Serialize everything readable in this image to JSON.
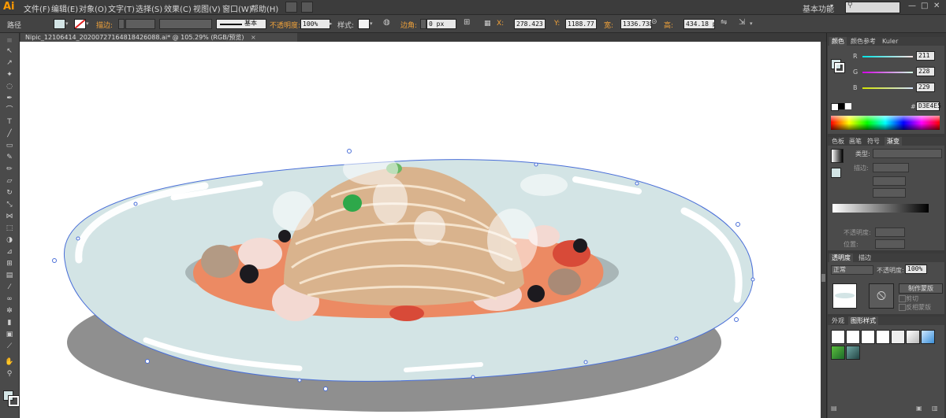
{
  "app": {
    "logo": "Ai"
  },
  "menu": [
    "文件(F)",
    "编辑(E)",
    "对象(O)",
    "文字(T)",
    "选择(S)",
    "效果(C)",
    "视图(V)",
    "窗口(W)",
    "帮助(H)"
  ],
  "workspace": {
    "label": "基本功能",
    "arrow": "▾"
  },
  "window_controls": {
    "minimize": "—",
    "maximize": "□",
    "close": "✕"
  },
  "control_bar": {
    "selection_label": "路径",
    "stroke_label": "描边:",
    "stroke_style": "基本",
    "opacity_label": "不透明度:",
    "opacity_value": "100%",
    "style_label": "样式:",
    "corner_label": "边角:",
    "corner_value": "0 px",
    "x_label": "X:",
    "x_value": "278.423 p",
    "y_label": "Y:",
    "y_value": "1188.77 p",
    "w_label": "宽:",
    "w_value": "1336.738",
    "h_label": "高:",
    "h_value": "434.18 px"
  },
  "document": {
    "tab_title": "Nipic_12106414_20200727164818426088.ai* @ 105.29% (RGB/预览)",
    "close": "×"
  },
  "color_panel": {
    "tabs": [
      "颜色",
      "颜色参考",
      "Kuler"
    ],
    "channels": [
      {
        "name": "R",
        "value": "211"
      },
      {
        "name": "G",
        "value": "228"
      },
      {
        "name": "B",
        "value": "229"
      }
    ],
    "hex_prefix": "#",
    "hex_value": "D3E4E5",
    "fill_color": "#d3e4e5"
  },
  "gradient_panel": {
    "tabs": [
      "色板",
      "画笔",
      "符号",
      "渐变"
    ],
    "type_label": "类型:",
    "stroke_label": "描边:",
    "opacity_label": "不透明度:",
    "position_label": "位置:"
  },
  "transparency_panel": {
    "tabs": [
      "透明度",
      "描边"
    ],
    "blend_mode": "正常",
    "opacity_label": "不透明度:",
    "opacity_value": "100%",
    "make_mask_button": "制作蒙版",
    "clip_label": "剪切",
    "invert_label": "反相蒙版"
  },
  "styles_panel": {
    "tabs": [
      "外观",
      "图形样式"
    ]
  },
  "tools": [
    "selection-icon",
    "direct-selection-icon",
    "magic-wand-icon",
    "lasso-icon",
    "pen-icon",
    "curvature-icon",
    "type-icon",
    "line-icon",
    "rectangle-icon",
    "paintbrush-icon",
    "pencil-icon",
    "eraser-icon",
    "rotate-icon",
    "scale-icon",
    "width-icon",
    "free-transform-icon",
    "shape-builder-icon",
    "perspective-icon",
    "mesh-icon",
    "gradient-icon",
    "eyedropper-icon",
    "blend-icon",
    "symbol-sprayer-icon",
    "column-graph-icon",
    "artboard-icon",
    "slice-icon",
    "hand-icon",
    "zoom-icon"
  ],
  "colors": {
    "accent": "#ff9a00",
    "selection_blue": "#4a6fd8",
    "plate": "#d3e4e5",
    "shadow": "#8f8f8f"
  }
}
